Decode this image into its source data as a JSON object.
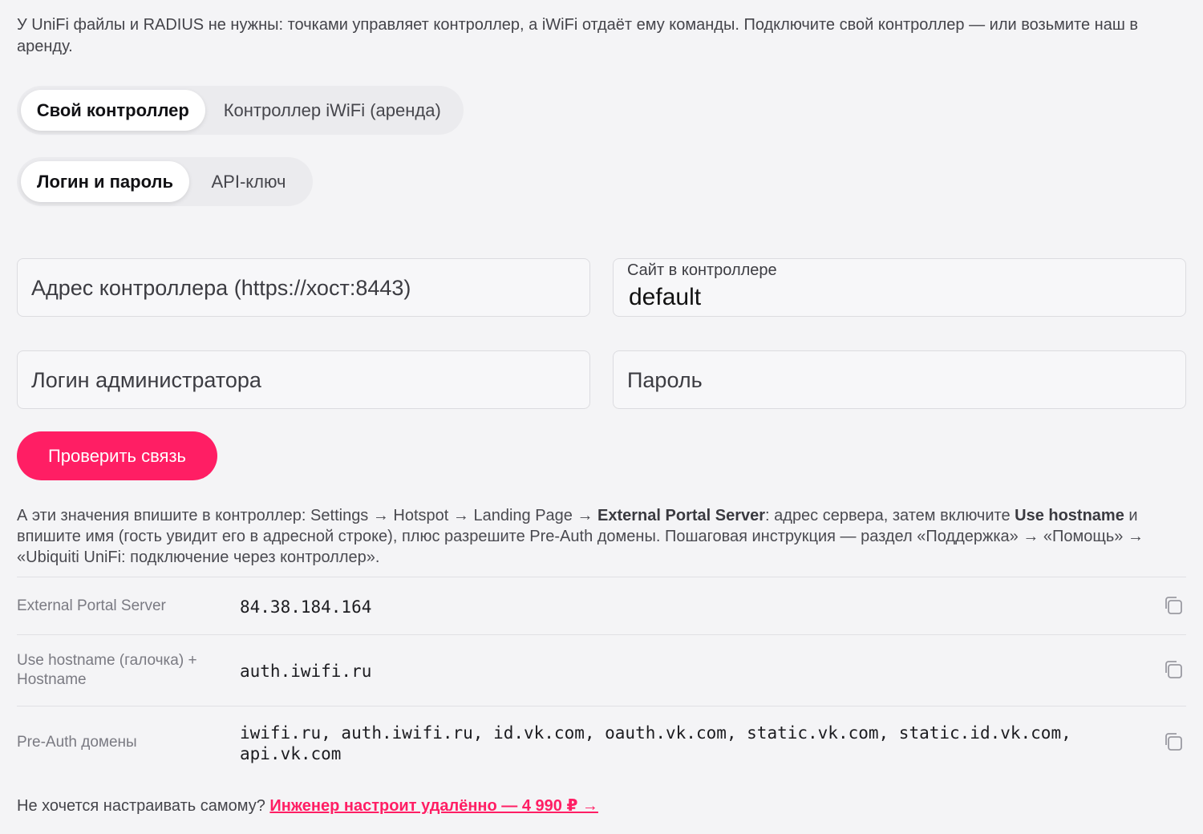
{
  "intro": "У UniFi файлы и RADIUS не нужны: точками управляет контроллер, а iWiFi отдаёт ему команды. Подключите свой контроллер — или возьмите наш в аренду.",
  "controller_tabs": [
    {
      "label": "Свой контроллер",
      "active": true
    },
    {
      "label": "Контроллер iWiFi (аренда)",
      "active": false
    }
  ],
  "auth_tabs": [
    {
      "label": "Логин и пароль",
      "active": true
    },
    {
      "label": "API-ключ",
      "active": false
    }
  ],
  "fields": {
    "address": {
      "placeholder": "Адрес контроллера (https://хост:8443)"
    },
    "site": {
      "label": "Сайт в контроллере",
      "value": "default"
    },
    "login": {
      "placeholder": "Логин администратора"
    },
    "password": {
      "placeholder": "Пароль"
    }
  },
  "check_button": "Проверить связь",
  "hint": {
    "p1": "А эти значения впишите в контроллер: Settings → Hotspot → Landing Page → ",
    "b1": "External Portal Server",
    "p2": ": адрес сервера, затем включите ",
    "b2": "Use hostname",
    "p3": " и впишите имя (гость увидит его в адресной строке), плюс разрешите Pre-Auth домены. Пошаговая инструкция — раздел «Поддержка» → «Помощь» → «Ubiquiti UniFi: подключение через контроллер»."
  },
  "values_table": [
    {
      "key": "External Portal Server",
      "value": "84.38.184.164",
      "icon": "copy-icon"
    },
    {
      "key": "Use hostname (галочка) + Hostname",
      "value": "auth.iwifi.ru",
      "icon": "copy-icon"
    },
    {
      "key": "Pre-Auth домены",
      "value": "iwifi.ru, auth.iwifi.ru, id.vk.com, oauth.vk.com, static.vk.com, static.id.vk.com, api.vk.com",
      "icon": "copy-icon"
    }
  ],
  "footer": {
    "text": "Не хочется настраивать самому? ",
    "link": "Инженер настроит удалённо — 4 990 ₽ →"
  },
  "colors": {
    "accent": "#ff1e64",
    "background": "#f4f4f6"
  }
}
